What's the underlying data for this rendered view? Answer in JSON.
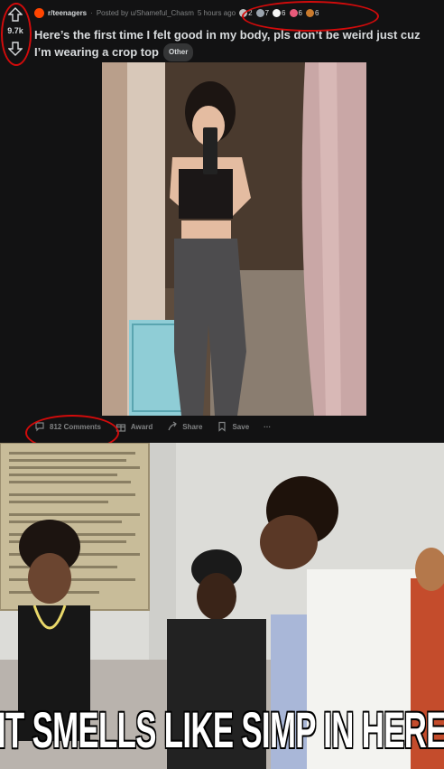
{
  "post": {
    "score": "9.7k",
    "subreddit": "r/teenagers",
    "posted_by": "Posted by u/Shameful_Chasm",
    "time": "5 hours ago",
    "awards": [
      {
        "icon": "silver-award-icon",
        "count": "2",
        "color": "#c0c0c0"
      },
      {
        "icon": "helpful-award-icon",
        "count": "7",
        "color": "#9aa3ad"
      },
      {
        "icon": "wholesome-award-icon",
        "count": "6",
        "color": "#f5f5f5"
      },
      {
        "icon": "heart-award-icon",
        "count": "6",
        "color": "#e85a7a"
      },
      {
        "icon": "poop-award-icon",
        "count": "6",
        "color": "#c97a2d"
      }
    ],
    "title": "Here’s the first time I felt good in my body, pls don’t be weird just cuz I’m wearing a crop top",
    "flair": "Other",
    "actions": {
      "comments": "812 Comments",
      "award": "Award",
      "share": "Share",
      "save": "Save",
      "more": "···"
    }
  },
  "meme": {
    "caption": "IT SMELLS LIKE SIMP IN HERE"
  },
  "colors": {
    "background": "#121213",
    "text": "#d7dadc",
    "muted": "#818384",
    "annotation": "#d20b0b"
  }
}
